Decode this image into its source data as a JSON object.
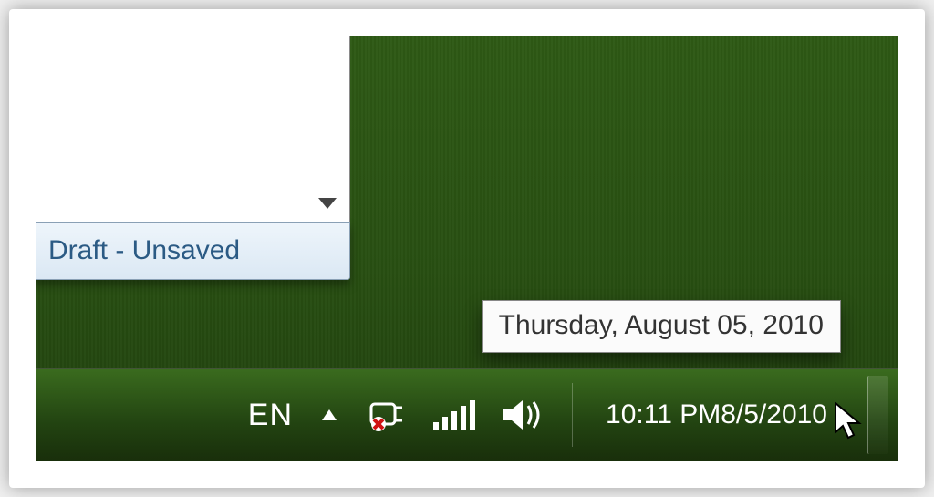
{
  "window": {
    "status_text": "Draft - Unsaved"
  },
  "tooltip": {
    "text": "Thursday, August 05, 2010"
  },
  "taskbar": {
    "language": "EN",
    "icons": {
      "hidden_tray": "show-hidden-icons",
      "power": "power-plug-error-icon",
      "network": "wifi-signal-icon",
      "volume": "speaker-icon"
    },
    "clock": {
      "time": "10:11 PM",
      "date": "8/5/2010"
    }
  }
}
